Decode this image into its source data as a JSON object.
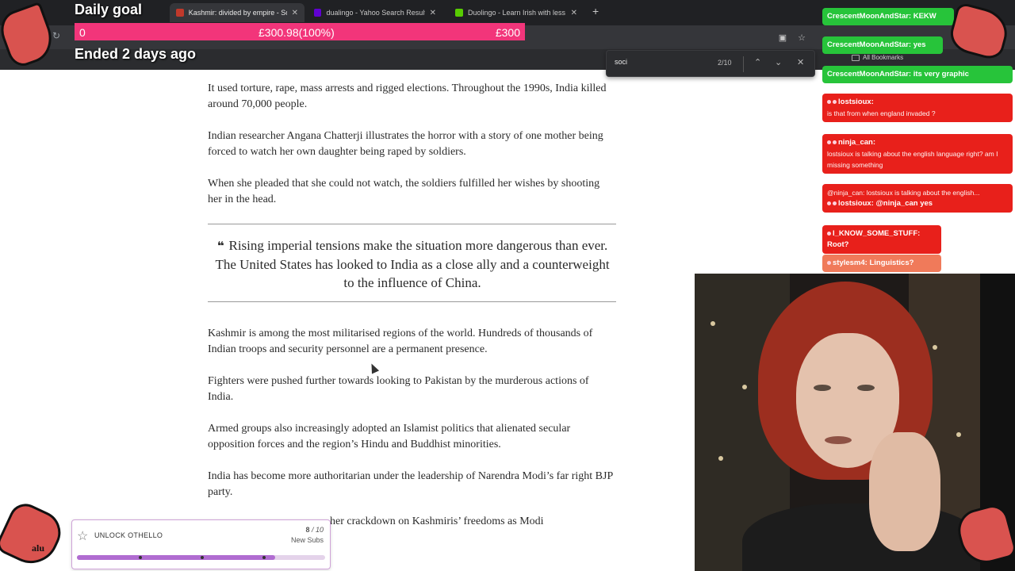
{
  "browser": {
    "tabs": [
      {
        "label": "Kashmir: divided by empire - So",
        "active": true
      },
      {
        "label": "dualingo - Yahoo Search Results",
        "active": false
      },
      {
        "label": "Duolingo - Learn Irish with less",
        "active": false
      }
    ],
    "new_tab": "+",
    "bookmarks_folder": "All Bookmarks"
  },
  "find_bar": {
    "query": "soci",
    "count": "2/10"
  },
  "goal": {
    "title": "Daily goal",
    "start": "0",
    "current": "£300.98(100%)",
    "target": "£300",
    "status": "Ended 2 days ago",
    "bar_color": "#f2357a"
  },
  "article": {
    "p1": "It used torture, rape, mass arrests and rigged elections. Throughout the 1990s, India killed around 70,000 people.",
    "p2": "Indian researcher Angana Chatterji illustrates the horror with a story of one mother being forced to watch her own daughter being raped by soldiers.",
    "p3": "When she pleaded that she could not watch, the soldiers fulfilled her wishes by shooting her in the head.",
    "pullquote": "Rising imperial tensions make the situation more dangerous than ever. The United States has looked to India as a close ally and a counterweight to the influence of China.",
    "quote_icon": "❝",
    "p4": "Kashmir is among the most militarised regions of the world. Hundreds of thousands of Indian troops and security personnel are a permanent presence.",
    "p5": "Fighters were pushed further towards looking to Pakistan by the murderous actions of India.",
    "p6": "Armed groups also increasingly adopted an Islamist politics that alienated secular opposition forces and the region’s Hindu and Buddhist minorities.",
    "p7": "India has become more authoritarian under the leadership of Narendra Modi’s far right BJP party.",
    "p8_partial": "her crackdown on Kashmiris’ freedoms as Modi"
  },
  "chat": [
    {
      "user": "CrescentMoonAndStar:",
      "text": " KEKW",
      "color": "green"
    },
    {
      "user": "CrescentMoonAndStar:",
      "text": " yes",
      "color": "green"
    },
    {
      "user": "CrescentMoonAndStar:",
      "text": " its very graphic",
      "color": "green"
    },
    {
      "user": "lostsioux:",
      "text": "is that from when england invaded ?",
      "color": "red"
    },
    {
      "user": "ninja_can:",
      "text": "lostsioux is talking about the english language right? am I missing something",
      "color": "red"
    },
    {
      "reply": "@ninja_can: lostsioux is talking about the english...",
      "user": "lostsioux:",
      "text": " @ninja_can yes",
      "color": "red"
    },
    {
      "user": "I_KNOW_SOME_STUFF:",
      "text": " Root?",
      "color": "red"
    },
    {
      "user": "stylesm4:",
      "text": " Linguistics?",
      "color": "orange"
    }
  ],
  "sub_goal": {
    "title": "UNLOCK OTHELLO",
    "current": "8",
    "total": "10",
    "separator": " / ",
    "caption": "New Subs",
    "progress": 0.8,
    "icon": "star-icon"
  },
  "overlay_text": {
    "side": "alu"
  }
}
